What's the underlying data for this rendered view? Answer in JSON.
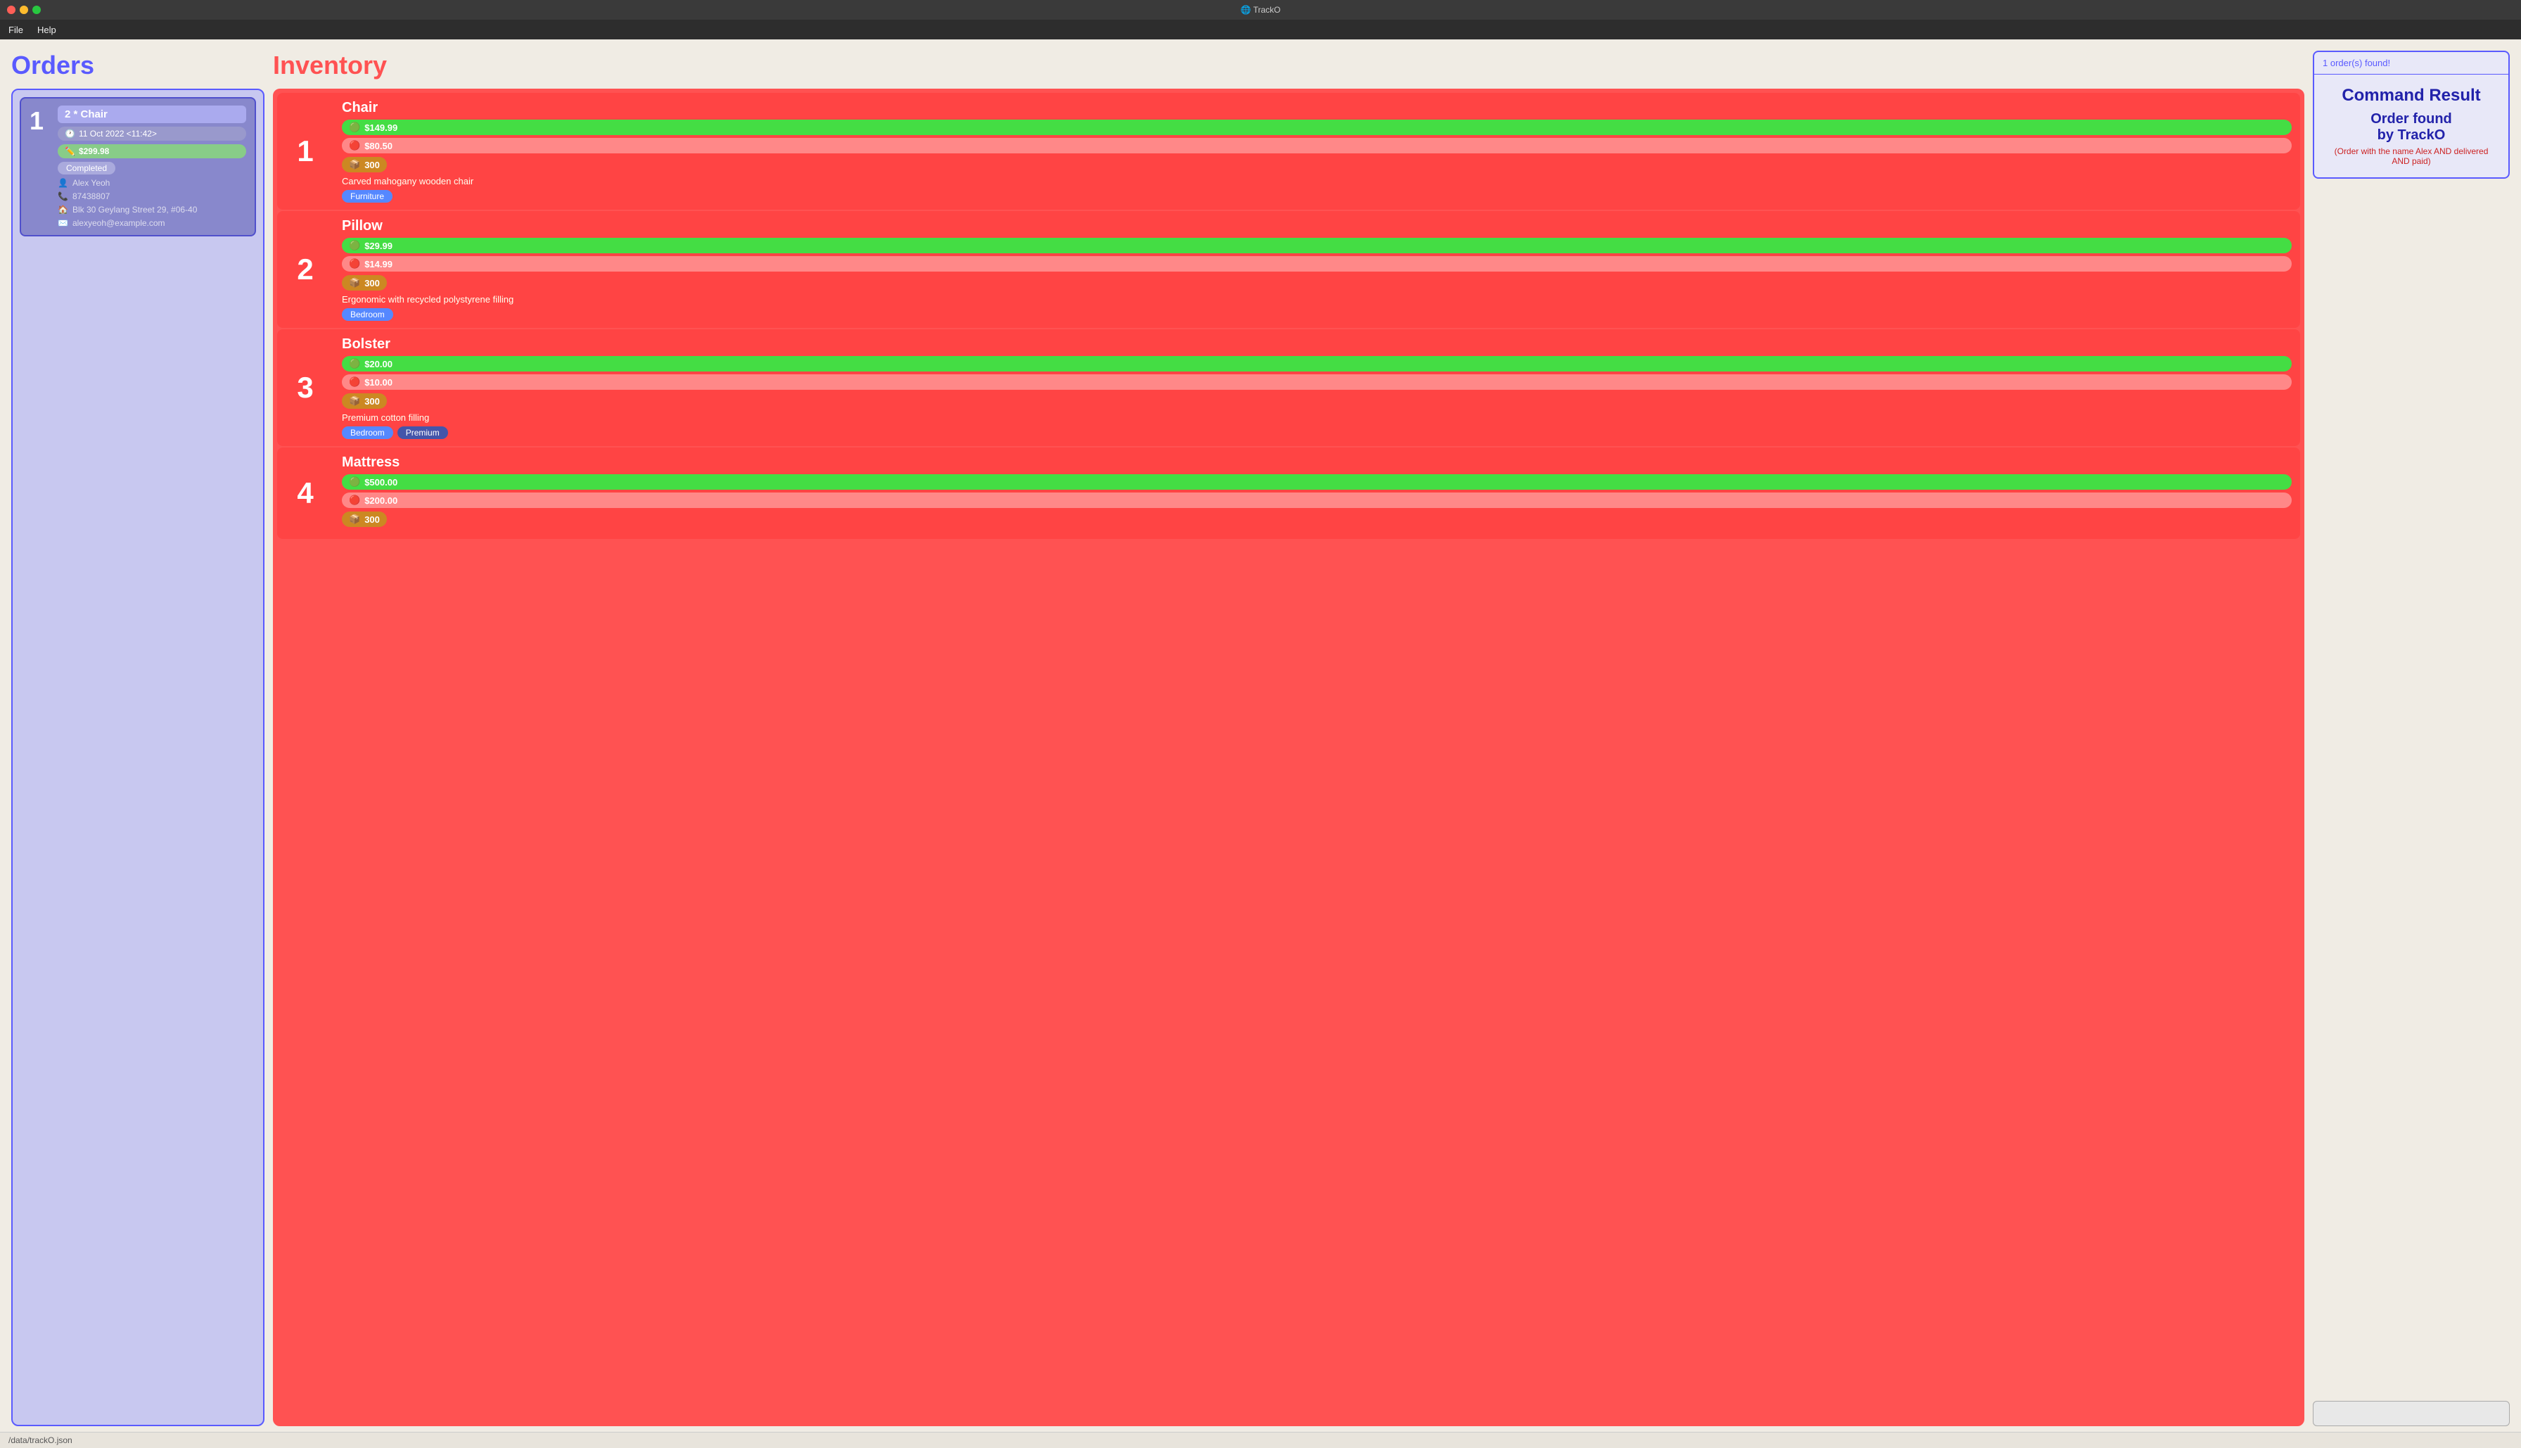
{
  "titleBar": {
    "title": "🌐 TrackO"
  },
  "menuBar": {
    "items": [
      "File",
      "Help"
    ]
  },
  "orders": {
    "sectionTitle": "Orders",
    "items": [
      {
        "number": "1",
        "name": "2 * Chair",
        "date": "11 Oct 2022 <11:42>",
        "price": "$299.98",
        "status": "Completed",
        "customer": "Alex Yeoh",
        "phone": "87438807",
        "address": "Blk 30 Geylang Street 29, #06-40",
        "email": "alexyeoh@example.com"
      }
    ]
  },
  "inventory": {
    "sectionTitle": "Inventory",
    "items": [
      {
        "number": "1",
        "name": "Chair",
        "sellPrice": "$149.99",
        "costPrice": "$80.50",
        "stock": "300",
        "description": "Carved mahogany wooden chair",
        "tags": [
          "Furniture"
        ]
      },
      {
        "number": "2",
        "name": "Pillow",
        "sellPrice": "$29.99",
        "costPrice": "$14.99",
        "stock": "300",
        "description": "Ergonomic with recycled polystyrene filling",
        "tags": [
          "Bedroom"
        ]
      },
      {
        "number": "3",
        "name": "Bolster",
        "sellPrice": "$20.00",
        "costPrice": "$10.00",
        "stock": "300",
        "description": "Premium cotton filling",
        "tags": [
          "Bedroom",
          "Premium"
        ]
      },
      {
        "number": "4",
        "name": "Mattress",
        "sellPrice": "$500.00",
        "costPrice": "$200.00",
        "stock": "300",
        "description": "",
        "tags": []
      }
    ]
  },
  "commandResult": {
    "header": "1 order(s) found!",
    "title": "Command Result",
    "mainText": "Order found\nby TrackO",
    "subText": "(Order with the name Alex AND delivered AND paid)"
  },
  "statusBar": {
    "path": "/data/trackO.json"
  },
  "icons": {
    "clock": "🕐",
    "pencil": "✏️",
    "person": "👤",
    "phone": "📞",
    "house": "🏠",
    "email": "✉️",
    "arrowUp": "↑",
    "arrowDown": "↓",
    "box": "📦"
  }
}
